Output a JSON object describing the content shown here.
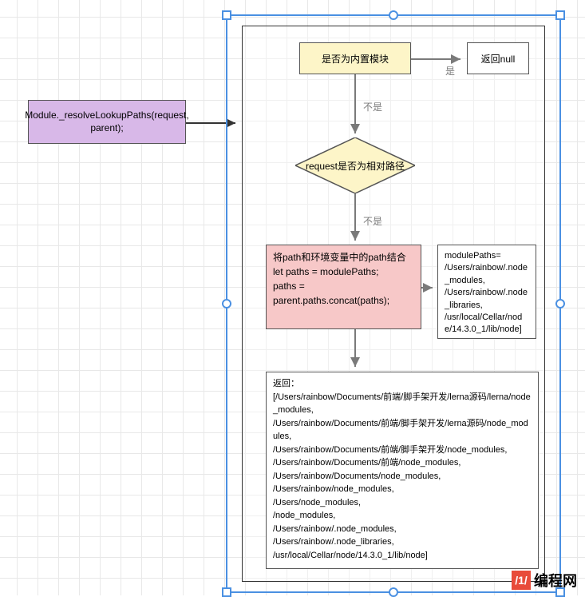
{
  "nodes": {
    "entry": "Module._resolveLookupPaths(request, parent);",
    "builtin_check": "是否为内置模块",
    "return_null": "返回null",
    "relative_check": "request是否为相对路径",
    "concat_paths_title": "将path和环境变量中的path结合",
    "concat_paths_code1": " let paths = modulePaths;",
    "concat_paths_code2": "paths =",
    "concat_paths_code3": "parent.paths.concat(paths);",
    "module_paths": "modulePaths=\n/Users/rainbow/.node_modules,\n/Users/rainbow/.node_libraries,\n/usr/local/Cellar/node/14.3.0_1/lib/node]",
    "return_title": "返回：",
    "return_body": "[/Users/rainbow/Documents/前端/脚手架开发/lerna源码/lerna/node_modules,\n/Users/rainbow/Documents/前端/脚手架开发/lerna源码/node_modules,\n/Users/rainbow/Documents/前端/脚手架开发/node_modules,\n/Users/rainbow/Documents/前端/node_modules,\n/Users/rainbow/Documents/node_modules,\n/Users/rainbow/node_modules,\n/Users/node_modules,\n/node_modules,\n/Users/rainbow/.node_modules,\n/Users/rainbow/.node_libraries,\n/usr/local/Cellar/node/14.3.0_1/lib/node]"
  },
  "labels": {
    "yes": "是",
    "no1": "不是",
    "no2": "不是"
  },
  "watermark": {
    "icon": "/1/",
    "text": "编程网"
  }
}
